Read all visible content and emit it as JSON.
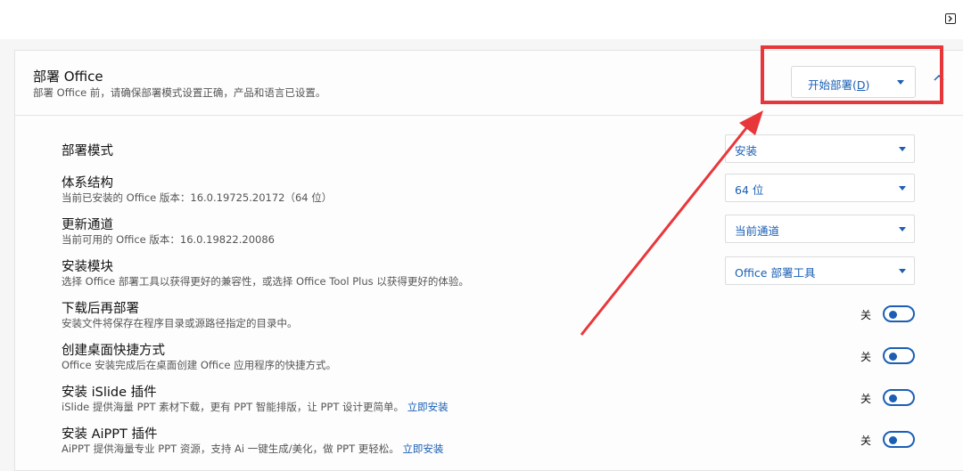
{
  "header": {
    "panel_icon": "panel-toggle-icon"
  },
  "deploy_section": {
    "title": "部署 Office",
    "subtitle": "部署 Office 前，请确保部署模式设置正确，产品和语言已设置。",
    "button_label": "开始部署(",
    "button_accesskey": "D",
    "button_suffix": ")",
    "collapse_icon": "chevron-up-icon"
  },
  "settings": {
    "mode": {
      "title": "部署模式",
      "value": "安装"
    },
    "arch": {
      "title": "体系结构",
      "desc": "当前已安装的 Office 版本：16.0.19725.20172（64 位）",
      "value": "64 位"
    },
    "channel": {
      "title": "更新通道",
      "desc": "当前可用的 Office 版本：16.0.19822.20086",
      "value": "当前通道"
    },
    "module": {
      "title": "安装模块",
      "desc": "选择 Office 部署工具以获得更好的兼容性，或选择 Office Tool Plus 以获得更好的体验。",
      "value": "Office 部署工具"
    },
    "download_then_deploy": {
      "title": "下载后再部署",
      "desc": "安装文件将保存在程序目录或源路径指定的目录中。",
      "state": "关"
    },
    "desktop_shortcut": {
      "title": "创建桌面快捷方式",
      "desc": "Office 安装完成后在桌面创建 Office 应用程序的快捷方式。",
      "state": "关"
    },
    "islide": {
      "title": "安装 iSlide 插件",
      "desc": "iSlide 提供海量 PPT 素材下载，更有 PPT 智能排版，让 PPT 设计更简单。",
      "link": "立即安装",
      "state": "关"
    },
    "aippt": {
      "title": "安装 AiPPT 插件",
      "desc": "AiPPT 提供海量专业 PPT 资源，支持 Ai 一键生成/美化，做 PPT 更轻松。",
      "link": "立即安装",
      "state": "关"
    }
  },
  "annotation": {
    "color": "#e8373a"
  },
  "colors": {
    "accent": "#1a5fb4"
  }
}
